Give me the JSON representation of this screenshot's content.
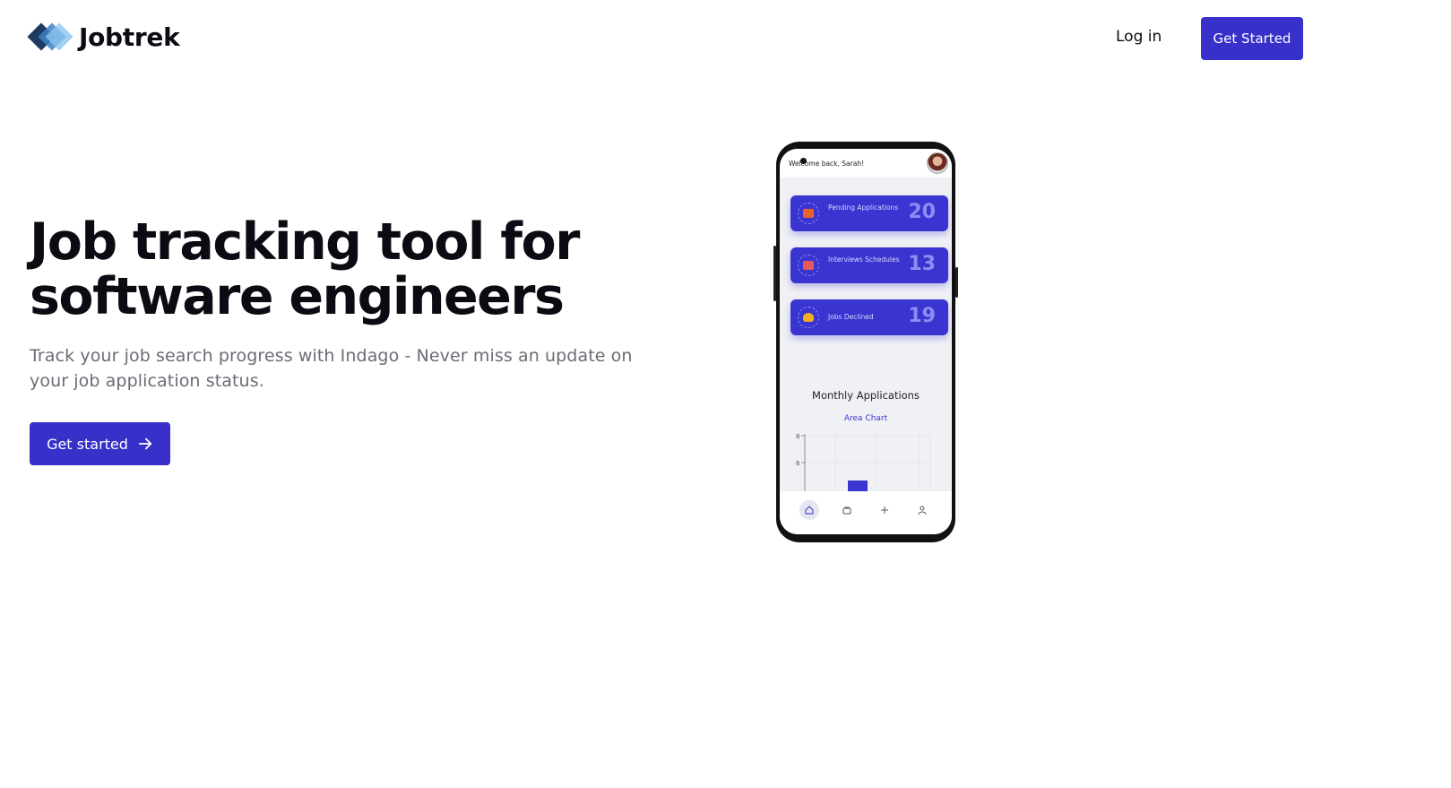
{
  "brand": {
    "name": "Jobtrek"
  },
  "header": {
    "login_label": "Log in",
    "get_started_label": "Get Started"
  },
  "hero": {
    "title": "Job tracking tool for software engineers",
    "subtitle": "Track your job search progress with Indago - Never miss an update on your job application status.",
    "cta_label": "Get started"
  },
  "phone": {
    "welcome": "Welcome back, Sarah!",
    "cards": [
      {
        "label": "Pending Applications",
        "value": "20",
        "icon": "briefcase-icon",
        "icon_color": "#e8632c"
      },
      {
        "label": "Interviews Schedules",
        "value": "13",
        "icon": "calendar-icon",
        "icon_color": "#e85a5a"
      },
      {
        "label": "Jobs Declined",
        "value": "19",
        "icon": "hand-icon",
        "icon_color": "#f2b01e"
      }
    ],
    "chart_title": "Monthly Applications",
    "chart_toggle": "Area Chart",
    "chart_ticks": [
      "8",
      "6"
    ],
    "nav": [
      "home-icon",
      "briefcase-icon",
      "plus-icon",
      "user-icon"
    ]
  },
  "colors": {
    "primary": "#3730c9",
    "text": "#0b0b14",
    "muted": "#6b6b74"
  }
}
